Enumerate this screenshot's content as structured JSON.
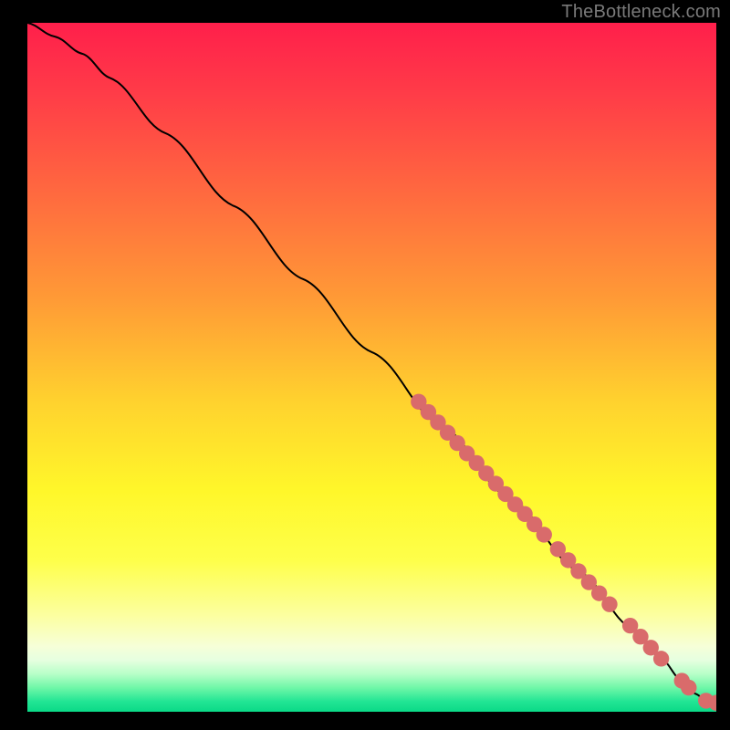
{
  "attribution": "TheBottleneck.com",
  "chart_data": {
    "type": "line",
    "title": "",
    "xlabel": "",
    "ylabel": "",
    "xlim": [
      0,
      100
    ],
    "ylim": [
      0,
      100
    ],
    "curve": {
      "x": [
        0,
        4,
        8,
        12,
        20,
        30,
        40,
        50,
        60,
        70,
        80,
        88,
        92,
        95,
        97,
        98.5,
        100
      ],
      "y": [
        100,
        98,
        95.5,
        92,
        84,
        73.4,
        62.8,
        52.2,
        41.6,
        31,
        20.4,
        11.9,
        7.7,
        4.5,
        2.6,
        1.6,
        1.3
      ]
    },
    "markers": [
      {
        "x": 56.8,
        "y": 45.0
      },
      {
        "x": 58.2,
        "y": 43.5
      },
      {
        "x": 59.6,
        "y": 42.0
      },
      {
        "x": 61.0,
        "y": 40.5
      },
      {
        "x": 62.4,
        "y": 39.0
      },
      {
        "x": 63.8,
        "y": 37.5
      },
      {
        "x": 65.2,
        "y": 36.1
      },
      {
        "x": 66.6,
        "y": 34.6
      },
      {
        "x": 68.0,
        "y": 33.1
      },
      {
        "x": 69.4,
        "y": 31.6
      },
      {
        "x": 70.8,
        "y": 30.1
      },
      {
        "x": 72.2,
        "y": 28.7
      },
      {
        "x": 73.6,
        "y": 27.2
      },
      {
        "x": 75.0,
        "y": 25.7
      },
      {
        "x": 77.0,
        "y": 23.6
      },
      {
        "x": 78.5,
        "y": 22.0
      },
      {
        "x": 80.0,
        "y": 20.4
      },
      {
        "x": 81.5,
        "y": 18.8
      },
      {
        "x": 83.0,
        "y": 17.2
      },
      {
        "x": 84.5,
        "y": 15.6
      },
      {
        "x": 87.5,
        "y": 12.5
      },
      {
        "x": 89.0,
        "y": 10.9
      },
      {
        "x": 90.5,
        "y": 9.3
      },
      {
        "x": 92.0,
        "y": 7.7
      },
      {
        "x": 95.0,
        "y": 4.5
      },
      {
        "x": 96.0,
        "y": 3.5
      },
      {
        "x": 98.5,
        "y": 1.6
      },
      {
        "x": 100.0,
        "y": 1.3
      }
    ],
    "gradient_stops": [
      {
        "offset": 0.0,
        "color": "#ff1f4b"
      },
      {
        "offset": 0.1,
        "color": "#ff3b48"
      },
      {
        "offset": 0.25,
        "color": "#ff6a3f"
      },
      {
        "offset": 0.4,
        "color": "#ff9a36"
      },
      {
        "offset": 0.55,
        "color": "#ffd22e"
      },
      {
        "offset": 0.68,
        "color": "#fff72a"
      },
      {
        "offset": 0.78,
        "color": "#feff4a"
      },
      {
        "offset": 0.86,
        "color": "#fcffa0"
      },
      {
        "offset": 0.905,
        "color": "#f6ffd8"
      },
      {
        "offset": 0.925,
        "color": "#e6ffe0"
      },
      {
        "offset": 0.945,
        "color": "#b8ffc8"
      },
      {
        "offset": 0.965,
        "color": "#70f7a8"
      },
      {
        "offset": 0.985,
        "color": "#22e594"
      },
      {
        "offset": 1.0,
        "color": "#0ad987"
      }
    ],
    "marker_color": "#d96b6b",
    "curve_color": "#000000"
  }
}
